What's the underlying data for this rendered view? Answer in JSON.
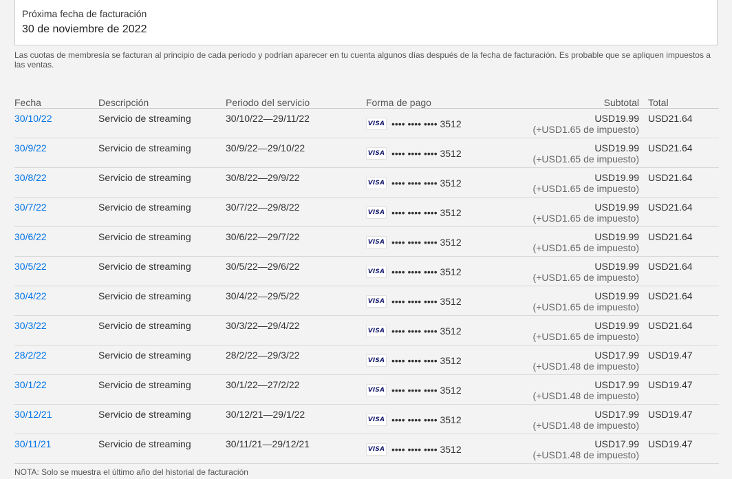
{
  "next_billing": {
    "label": "Próxima fecha de facturación",
    "value": "30 de noviembre de 2022"
  },
  "disclaimer": "Las cuotas de membresía se facturan al principio de cada periodo y podrían aparecer en tu cuenta algunos días después de la fecha de facturación. Es probable que se apliquen impuestos a las ventas.",
  "table": {
    "headers": {
      "date": "Fecha",
      "description": "Descripción",
      "period": "Periodo del servicio",
      "payment": "Forma de pago",
      "subtotal": "Subtotal",
      "total": "Total"
    },
    "rows": [
      {
        "date": "30/10/22",
        "description": "Servicio de streaming",
        "period": "30/10/22—29/11/22",
        "card_brand": "VISA",
        "card_number": "•••• •••• •••• 3512",
        "subtotal": "USD19.99",
        "tax": "(+USD1.65 de impuesto)",
        "total": "USD21.64"
      },
      {
        "date": "30/9/22",
        "description": "Servicio de streaming",
        "period": "30/9/22—29/10/22",
        "card_brand": "VISA",
        "card_number": "•••• •••• •••• 3512",
        "subtotal": "USD19.99",
        "tax": "(+USD1.65 de impuesto)",
        "total": "USD21.64"
      },
      {
        "date": "30/8/22",
        "description": "Servicio de streaming",
        "period": "30/8/22—29/9/22",
        "card_brand": "VISA",
        "card_number": "•••• •••• •••• 3512",
        "subtotal": "USD19.99",
        "tax": "(+USD1.65 de impuesto)",
        "total": "USD21.64"
      },
      {
        "date": "30/7/22",
        "description": "Servicio de streaming",
        "period": "30/7/22—29/8/22",
        "card_brand": "VISA",
        "card_number": "•••• •••• •••• 3512",
        "subtotal": "USD19.99",
        "tax": "(+USD1.65 de impuesto)",
        "total": "USD21.64"
      },
      {
        "date": "30/6/22",
        "description": "Servicio de streaming",
        "period": "30/6/22—29/7/22",
        "card_brand": "VISA",
        "card_number": "•••• •••• •••• 3512",
        "subtotal": "USD19.99",
        "tax": "(+USD1.65 de impuesto)",
        "total": "USD21.64"
      },
      {
        "date": "30/5/22",
        "description": "Servicio de streaming",
        "period": "30/5/22—29/6/22",
        "card_brand": "VISA",
        "card_number": "•••• •••• •••• 3512",
        "subtotal": "USD19.99",
        "tax": "(+USD1.65 de impuesto)",
        "total": "USD21.64"
      },
      {
        "date": "30/4/22",
        "description": "Servicio de streaming",
        "period": "30/4/22—29/5/22",
        "card_brand": "VISA",
        "card_number": "•••• •••• •••• 3512",
        "subtotal": "USD19.99",
        "tax": "(+USD1.65 de impuesto)",
        "total": "USD21.64"
      },
      {
        "date": "30/3/22",
        "description": "Servicio de streaming",
        "period": "30/3/22—29/4/22",
        "card_brand": "VISA",
        "card_number": "•••• •••• •••• 3512",
        "subtotal": "USD19.99",
        "tax": "(+USD1.65 de impuesto)",
        "total": "USD21.64"
      },
      {
        "date": "28/2/22",
        "description": "Servicio de streaming",
        "period": "28/2/22—29/3/22",
        "card_brand": "VISA",
        "card_number": "•••• •••• •••• 3512",
        "subtotal": "USD17.99",
        "tax": "(+USD1.48 de impuesto)",
        "total": "USD19.47"
      },
      {
        "date": "30/1/22",
        "description": "Servicio de streaming",
        "period": "30/1/22—27/2/22",
        "card_brand": "VISA",
        "card_number": "•••• •••• •••• 3512",
        "subtotal": "USD17.99",
        "tax": "(+USD1.48 de impuesto)",
        "total": "USD19.47"
      },
      {
        "date": "30/12/21",
        "description": "Servicio de streaming",
        "period": "30/12/21—29/1/22",
        "card_brand": "VISA",
        "card_number": "•••• •••• •••• 3512",
        "subtotal": "USD17.99",
        "tax": "(+USD1.48 de impuesto)",
        "total": "USD19.47"
      },
      {
        "date": "30/11/21",
        "description": "Servicio de streaming",
        "period": "30/11/21—29/12/21",
        "card_brand": "VISA",
        "card_number": "•••• •••• •••• 3512",
        "subtotal": "USD17.99",
        "tax": "(+USD1.48 de impuesto)",
        "total": "USD19.47"
      }
    ]
  },
  "note": "NOTA: Solo se muestra el último año del historial de facturación",
  "colors": {
    "link": "#0073e6",
    "background": "#f3f3f3",
    "visa_blue": "#1a1f71"
  }
}
